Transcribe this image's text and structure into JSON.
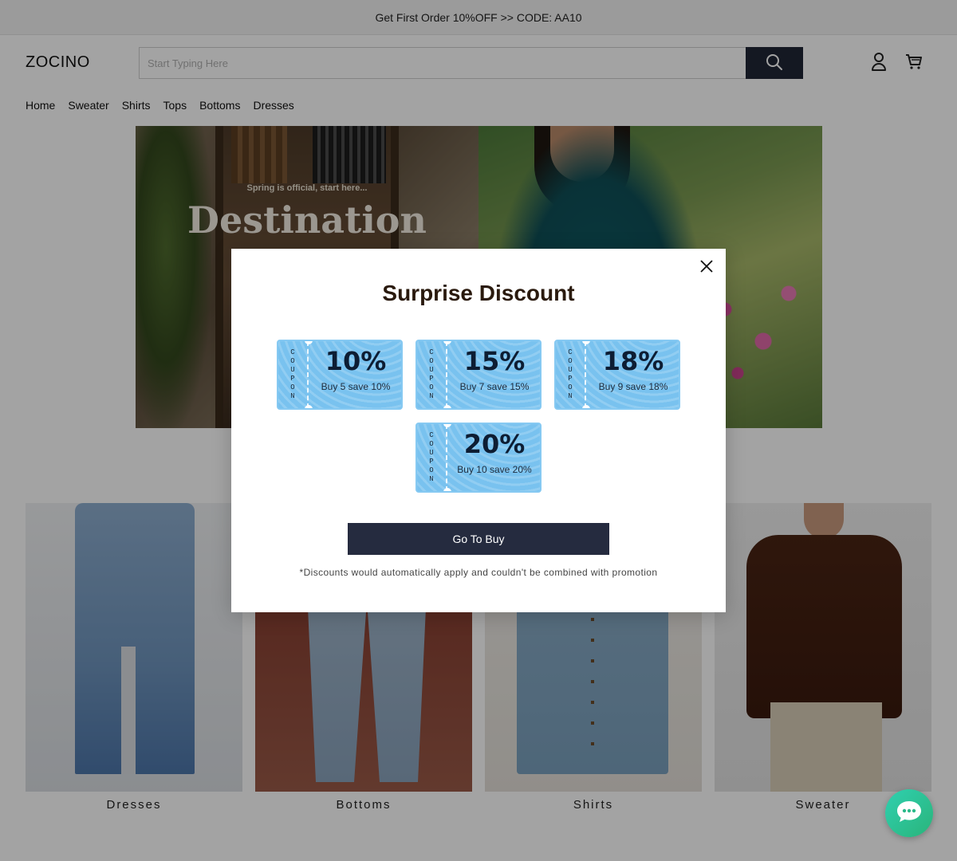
{
  "announcement": "Get First Order 10%OFF >> CODE: AA10",
  "header": {
    "logo": "ZOCINO",
    "search": {
      "placeholder": "Start Typing Here",
      "value": ""
    }
  },
  "nav": [
    "Home",
    "Sweater",
    "Shirts",
    "Tops",
    "Bottoms",
    "Dresses"
  ],
  "hero": {
    "kicker": "Spring is official, start here...",
    "title": "Destination Tropics"
  },
  "categories": [
    "Dresses",
    "Bottoms",
    "Shirts",
    "Sweater"
  ],
  "modal": {
    "title": "Surprise Discount",
    "coupon_stub_label": "COUPON",
    "coupons": [
      {
        "percent": "10%",
        "desc": "Buy 5 save 10%"
      },
      {
        "percent": "15%",
        "desc": "Buy 7 save 15%"
      },
      {
        "percent": "18%",
        "desc": "Buy 9 save 18%"
      },
      {
        "percent": "20%",
        "desc": "Buy 10 save 20%"
      }
    ],
    "button": "Go To Buy",
    "note": "*Discounts would automatically apply and couldn't be combined with promotion"
  },
  "colors": {
    "accent_dark": "#252b3f",
    "coupon_blue": "#79c2ef",
    "chat_green": "#2fd0b0"
  },
  "icons": [
    "search-icon",
    "user-icon",
    "cart-icon",
    "close-icon",
    "chat-icon"
  ]
}
